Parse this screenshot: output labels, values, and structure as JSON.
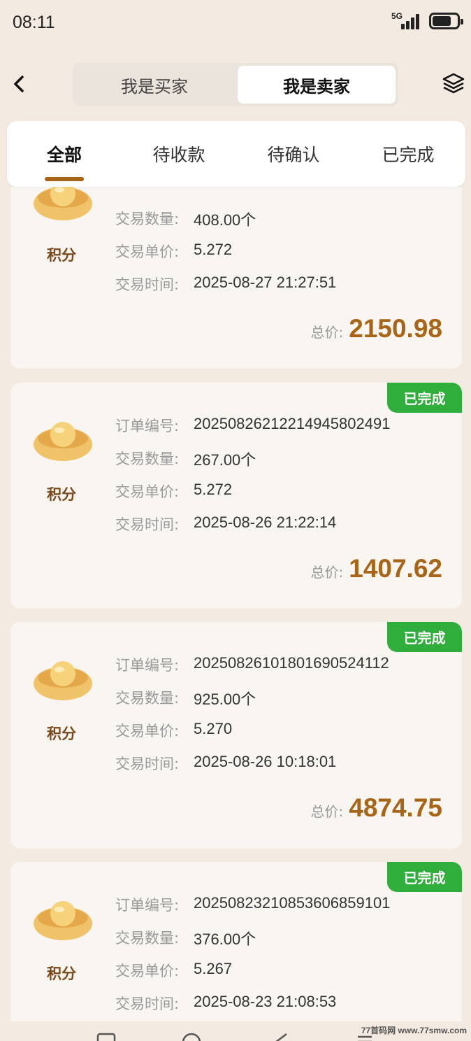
{
  "status_bar": {
    "time": "08:11",
    "network": "5G",
    "signal_level": 4,
    "battery_level": 0.75
  },
  "nav": {
    "segments": [
      {
        "label": "我是买家",
        "active": false
      },
      {
        "label": "我是卖家",
        "active": true
      }
    ]
  },
  "tabs": [
    {
      "label": "全部",
      "active": true
    },
    {
      "label": "待收款",
      "active": false
    },
    {
      "label": "待确认",
      "active": false
    },
    {
      "label": "已完成",
      "active": false
    }
  ],
  "labels": {
    "order_no": "订单编号:",
    "quantity": "交易数量:",
    "unit_price": "交易单价:",
    "time": "交易时间:",
    "total": "总价:"
  },
  "orders": [
    {
      "coin": "积分",
      "status": "",
      "order_no": "",
      "quantity": "408.00个",
      "unit_price": "5.272",
      "time": "2025-08-27 21:27:51",
      "total": "2150.98"
    },
    {
      "coin": "积分",
      "status": "已完成",
      "order_no": "20250826212214945802491",
      "quantity": "267.00个",
      "unit_price": "5.272",
      "time": "2025-08-26 21:22:14",
      "total": "1407.62"
    },
    {
      "coin": "积分",
      "status": "已完成",
      "order_no": "20250826101801690524112",
      "quantity": "925.00个",
      "unit_price": "5.270",
      "time": "2025-08-26 10:18:01",
      "total": "4874.75"
    },
    {
      "coin": "积分",
      "status": "已完成",
      "order_no": "20250823210853606859101",
      "quantity": "376.00个",
      "unit_price": "5.267",
      "time": "2025-08-23 21:08:53",
      "total": ""
    }
  ],
  "watermark": "77首码网 www.77smw.com",
  "colors": {
    "accent": "#a86518",
    "badge": "#2fae3b",
    "background": "#f3ebe2"
  }
}
